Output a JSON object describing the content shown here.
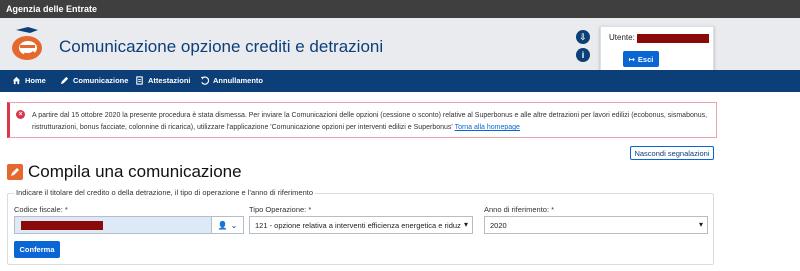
{
  "topbar": {
    "org_name": "Agenzia delle Entrate"
  },
  "header": {
    "app_title": "Comunicazione opzione crediti e detrazioni",
    "user_label": "Utente:",
    "logout_label": "Esci"
  },
  "nav": {
    "items": [
      {
        "label": "Home",
        "icon": "home-icon"
      },
      {
        "label": "Comunicazione",
        "icon": "pencil-icon"
      },
      {
        "label": "Attestazioni",
        "icon": "document-icon"
      },
      {
        "label": "Annullamento",
        "icon": "undo-icon"
      }
    ]
  },
  "alert": {
    "text": "A partire dal 15 ottobre 2020 la presente procedura è stata dismessa. Per inviare la Comunicazioni delle opzioni (cessione o sconto) relative al Superbonus e alle altre detrazioni per lavori edilizi (ecobonus, sismabonus, ristrutturazioni, bonus facciate, colonnine di ricarica), utilizzare l'applicazione 'Comunicazione opzioni per interventi edilizi e Superbonus'",
    "link_label": "Torna alla homepage"
  },
  "hide_alerts_label": "Nascondi segnalazioni",
  "page_title": "Compila una comunicazione",
  "form": {
    "legend": "Indicare il titolare del credito o della detrazione, il tipo di operazione e l'anno di riferimento",
    "codice_fiscale_label": "Codice fiscale: *",
    "tipo_operazione_label": "Tipo Operazione: *",
    "tipo_operazione_value": "121 - opzione relativa a interventi efficienza energetica e riduz",
    "anno_label": "Anno di riferimento: *",
    "anno_value": "2020",
    "confirm_label": "Conferma"
  },
  "colors": {
    "brand_blue": "#0c3f78",
    "button_blue": "#0a66d5",
    "alert_red": "#d9364a",
    "redaction": "#8a0a0a"
  }
}
